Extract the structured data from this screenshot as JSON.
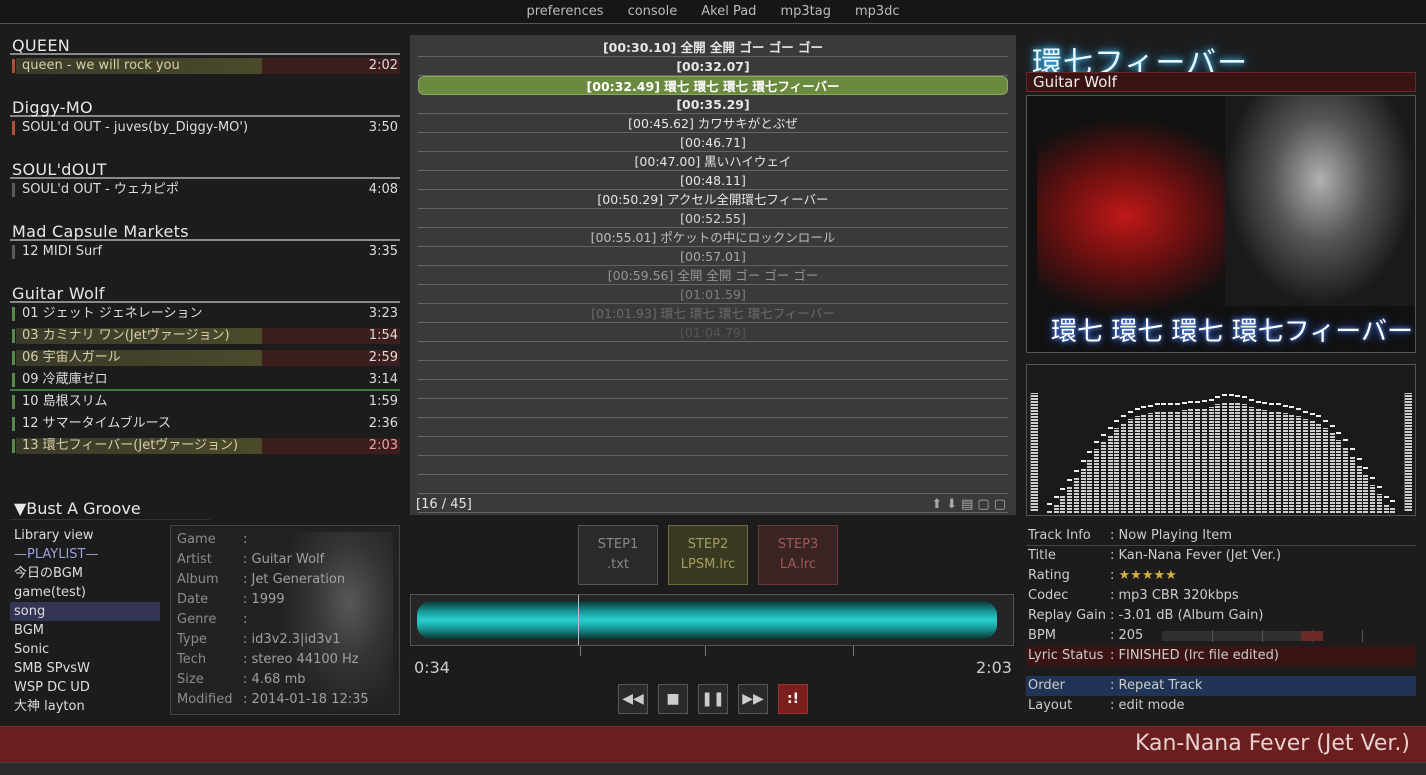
{
  "menu": {
    "items": [
      "preferences",
      "console",
      "Akel Pad",
      "mp3tag",
      "mp3dc"
    ]
  },
  "groups": [
    {
      "title": "QUEEN",
      "tracks": [
        {
          "name": "queen - we will rock you",
          "dur": "2:02",
          "state": "sel",
          "progress": 0.63
        }
      ]
    },
    {
      "title": "Diggy-MO",
      "tracks": [
        {
          "name": "SOUL'd OUT - juves(by_Diggy-MO')",
          "dur": "3:50",
          "state": "",
          "progress": 0.0
        }
      ]
    },
    {
      "title": "SOUL'dOUT",
      "tracks": [
        {
          "name": "SOUL'd OUT - ウェカピポ",
          "dur": "4:08",
          "state": "",
          "progress": 0.0
        }
      ]
    },
    {
      "title": "Mad Capsule Markets",
      "tracks": [
        {
          "name": "12 MIDI Surf",
          "dur": "3:35",
          "state": "",
          "progress": 0.0
        }
      ]
    },
    {
      "title": "Guitar Wolf",
      "tracks": [
        {
          "name": "01 ジェット ジェネレーション",
          "dur": "3:23",
          "state": "",
          "progress": 0.0
        },
        {
          "name": "03 カミナリ ワン(Jetヴァージョン)",
          "dur": "1:54",
          "state": "sel",
          "progress": 0.63
        },
        {
          "name": "06 宇宙人ガール",
          "dur": "2:59",
          "state": "sel",
          "progress": 0.63
        },
        {
          "name": "09 冷蔵庫ゼロ",
          "dur": "3:14",
          "state": "",
          "progress": 0.0
        },
        {
          "name": "10 島根スリム",
          "dur": "1:59",
          "state": "",
          "progress": 0.0
        },
        {
          "name": "12 サマータイムブルース",
          "dur": "2:36",
          "state": "",
          "progress": 0.0
        },
        {
          "name": "13 環七フィーバー(Jetヴァージョン)",
          "dur": "2:03",
          "state": "cur",
          "progress": 0.63
        }
      ]
    }
  ],
  "library": {
    "title": "▼Bust A Groove",
    "items": [
      "Library view",
      "—PLAYLIST—",
      "今日のBGM",
      "game(test)",
      "song",
      "BGM",
      "Sonic",
      "SMB SPvsW",
      "WSP DC UD",
      "大神 layton"
    ],
    "active": "song"
  },
  "meta": [
    {
      "k": "Game",
      "v": ""
    },
    {
      "k": "Artist",
      "v": "Guitar Wolf"
    },
    {
      "k": "Album",
      "v": "Jet Generation"
    },
    {
      "k": "Date",
      "v": "1999"
    },
    {
      "k": "Genre",
      "v": ""
    },
    {
      "k": "Type",
      "v": "id3v2.3|id3v1"
    },
    {
      "k": "Tech",
      "v": "stereo 44100 Hz"
    },
    {
      "k": "Size",
      "v": "4.68 mb"
    },
    {
      "k": "Modified",
      "v": "2014-01-18 12:35"
    }
  ],
  "lyrics": {
    "lines": [
      "[00:30.10] 全開 全開 ゴー ゴー ゴー",
      "[00:32.07]",
      "[00:32.49] 環七 環七 環七 環七フィーバー",
      "[00:35.29]",
      "[00:45.62] カワサキがとぶぜ",
      "[00:46.71]",
      "[00:47.00] 黒いハイウェイ",
      "[00:48.11]",
      "[00:50.29] アクセル全開環七フィーバー",
      "[00:52.55]",
      "[00:55.01] ポケットの中にロックンロール",
      "[00:57.01]",
      "[00:59.56] 全開 全開 ゴー ゴー ゴー",
      "[01:01.59]",
      "[01:01.93] 環七 環七 環七 環七フィーバー",
      "[01:04.79]",
      "",
      "",
      "",
      "",
      "",
      "",
      "",
      "",
      ""
    ],
    "highlight": 2,
    "counter": "[16 / 45]",
    "icons": "⬆⬇▤▢▢"
  },
  "steps": [
    {
      "t": "STEP1",
      "s": ".txt"
    },
    {
      "t": "STEP2",
      "s": "LPSM.lrc"
    },
    {
      "t": "STEP3",
      "s": "LA.lrc"
    }
  ],
  "playback": {
    "position": "0:34",
    "length": "2:03",
    "progress": 0.2764
  },
  "controls": {
    "prev": "◀◀",
    "stop": "■",
    "pause": "❚❚",
    "next": "▶▶",
    "rnd": ":!"
  },
  "now": {
    "title": "環七フィーバー",
    "artist": "Guitar Wolf",
    "cover_caption": "環七 環七 環七 環七フィーバー"
  },
  "spectrum": [
    2,
    8,
    14,
    22,
    30,
    38,
    46,
    54,
    60,
    66,
    72,
    76,
    80,
    82,
    84,
    85,
    86,
    86,
    86,
    86,
    87,
    88,
    88,
    89,
    90,
    92,
    94,
    94,
    93,
    92,
    90,
    88,
    87,
    86,
    86,
    85,
    84,
    82,
    80,
    78,
    76,
    72,
    68,
    62,
    56,
    48,
    40,
    32,
    24,
    16,
    8,
    4
  ],
  "info": {
    "header": {
      "k": "Track Info",
      "v": ": Now Playing Item"
    },
    "rows": [
      {
        "k": "Title",
        "v": ": Kan-Nana Fever (Jet Ver.)"
      },
      {
        "k": "Rating",
        "v": ": ",
        "stars": "★★★★★"
      },
      {
        "k": "Codec",
        "v": ": mp3 CBR 320kbps"
      },
      {
        "k": "Replay Gain",
        "v": ": -3.01 dB (Album Gain)"
      },
      {
        "k": "BPM",
        "v": ": 205"
      }
    ],
    "lyric": {
      "k": "Lyric Status",
      "v": ": FINISHED (lrc file edited)"
    },
    "order": {
      "k": "Order",
      "v": ": Repeat Track"
    },
    "layout": {
      "k": "Layout",
      "v": ": edit mode"
    }
  },
  "bpm_level": 0.62,
  "footer": {
    "title": "Kan-Nana Fever (Jet Ver.)"
  },
  "colors": {
    "accent": "#6a8a40",
    "footer": "#6a1e1e",
    "cyan": "#2ad0d0",
    "red": "#7a1e1e"
  }
}
